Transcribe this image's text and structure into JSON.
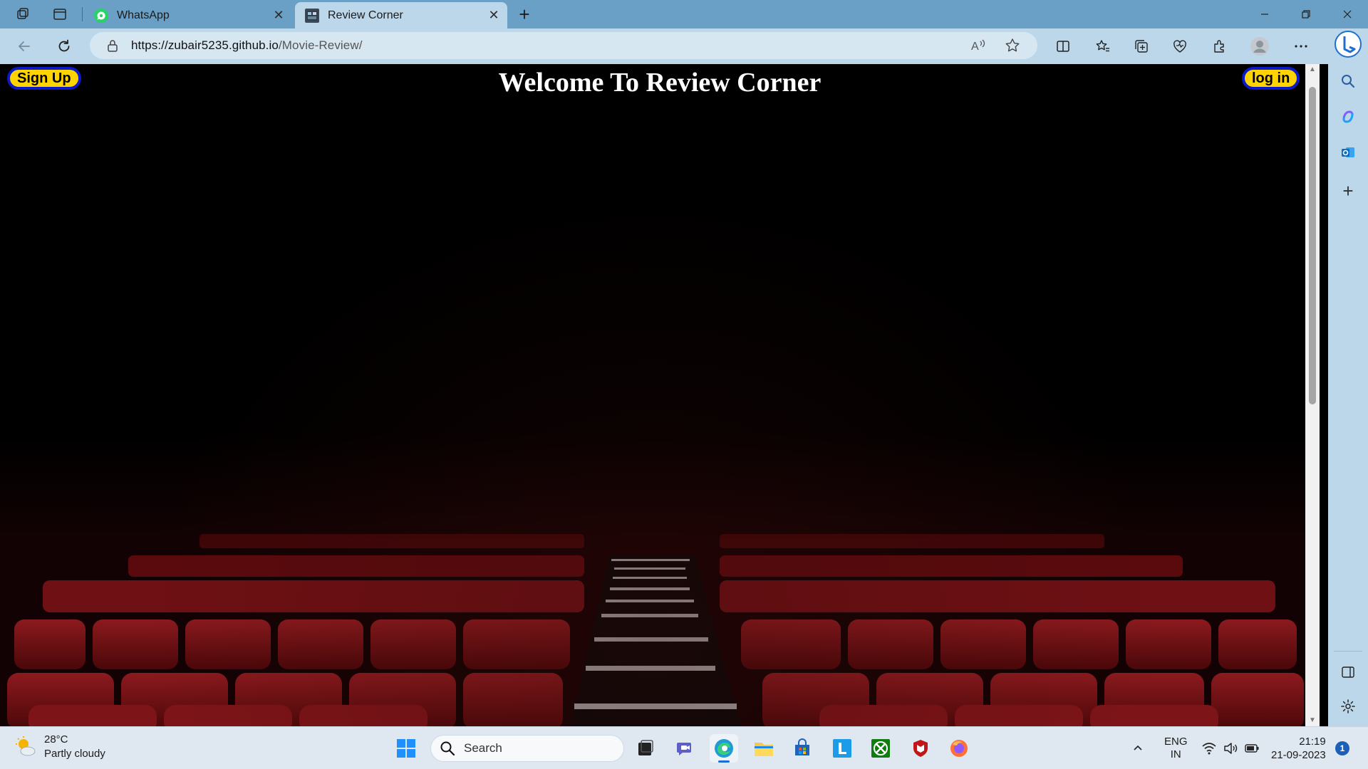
{
  "browser": {
    "tabs": [
      {
        "label": "WhatsApp",
        "active": false
      },
      {
        "label": "Review Corner",
        "active": true
      }
    ],
    "url_host": "https://zubair5235.github.io",
    "url_path": "/Movie-Review/"
  },
  "page": {
    "title": "Welcome To Review Corner",
    "signup_label": "Sign Up",
    "login_label": "log in",
    "colors": {
      "button_fill": "#ffd400",
      "button_border": "#0b19c8",
      "seat_red": "#7a1015"
    }
  },
  "taskbar": {
    "weather_temp": "28°C",
    "weather_desc": "Partly cloudy",
    "search_label": "Search",
    "lang_1": "ENG",
    "lang_2": "IN",
    "time": "21:19",
    "date": "21-09-2023",
    "notification_count": "1"
  }
}
